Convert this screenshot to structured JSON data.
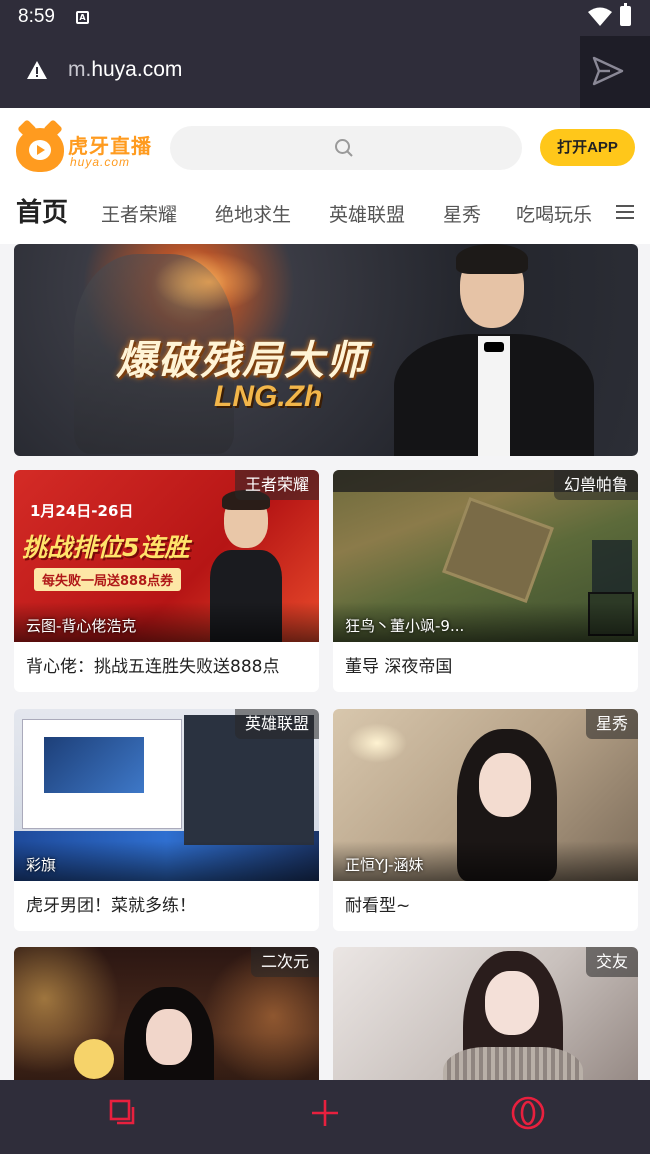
{
  "status_bar": {
    "time": "8:59",
    "notif_letter": "A"
  },
  "address_bar": {
    "url_prefix": "m.",
    "url_host": "huya.com"
  },
  "header": {
    "logo_cn": "虎牙直播",
    "logo_en": "huya.com",
    "open_app_label": "打开APP"
  },
  "nav": {
    "tabs": [
      "首页",
      "王者荣耀",
      "绝地求生",
      "英雄联盟",
      "星秀",
      "吃喝玩乐"
    ]
  },
  "banner": {
    "title": "爆破残局大师",
    "subtitle": "LNG.Zh"
  },
  "cards": [
    {
      "tag": "王者荣耀",
      "streamer": "云图-背心佬浩克",
      "title": "背心佬：挑战五连胜失败送888点",
      "thumb_texts": [
        "1月24日-26日",
        "挑战排位5连胜",
        "每失败一局送888点券"
      ]
    },
    {
      "tag": "幻兽帕鲁",
      "streamer": "狂鸟丶董小飒-9...",
      "title": "董导 深夜帝国"
    },
    {
      "tag": "英雄联盟",
      "streamer": "彩旗",
      "title": "虎牙男团！菜就多练！"
    },
    {
      "tag": "星秀",
      "streamer": "正恒YJ-涵妹",
      "title": "耐看型~"
    },
    {
      "tag": "二次元",
      "streamer": "",
      "title": ""
    },
    {
      "tag": "交友",
      "streamer": "",
      "title": ""
    }
  ],
  "colors": {
    "chrome_bg": "#2f2d3a",
    "accent_yellow": "#ffc71a",
    "brand_orange": "#ff9b1f",
    "bottom_icon_red": "#e8203e"
  },
  "icons": [
    "warning-icon",
    "send-icon",
    "search-icon",
    "menu-icon",
    "tabs-icon",
    "plus-icon",
    "opera-icon",
    "wifi-icon",
    "battery-icon"
  ]
}
